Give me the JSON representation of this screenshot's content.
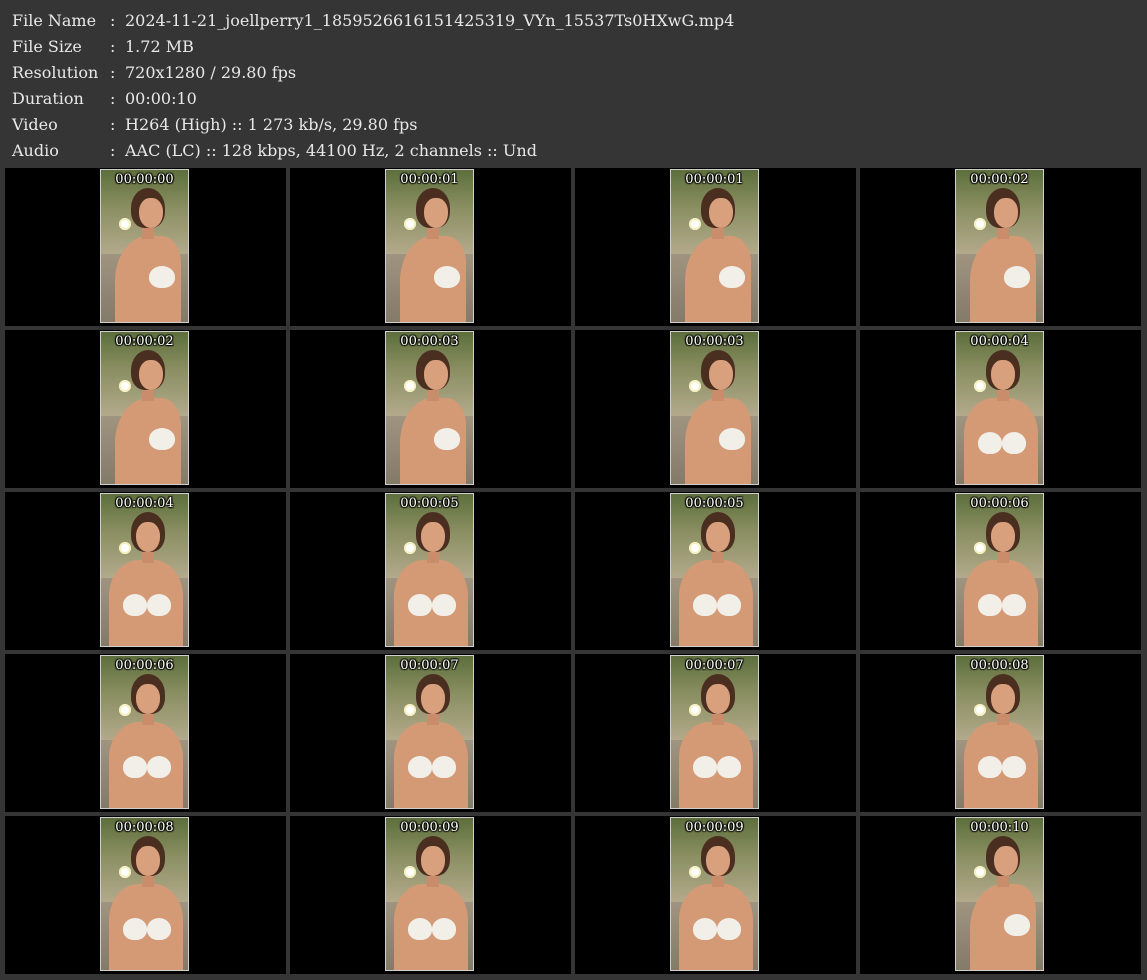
{
  "info": [
    {
      "key": "File Name",
      "sep": ":",
      "value": "2024-11-21_joellperry1_1859526616151425319_VYn_15537Ts0HXwG.mp4"
    },
    {
      "key": "File Size",
      "sep": ":",
      "value": "1.72 MB"
    },
    {
      "key": "Resolution",
      "sep": ":",
      "value": "720x1280 / 29.80 fps"
    },
    {
      "key": "Duration",
      "sep": ":",
      "value": "00:00:10"
    },
    {
      "key": "Video",
      "sep": ":",
      "value": "H264 (High) :: 1 273 kb/s, 29.80 fps"
    },
    {
      "key": "Audio",
      "sep": ":",
      "value": "AAC (LC) :: 128 kbps, 44100 Hz, 2 channels :: Und"
    }
  ],
  "thumbnails": [
    {
      "timestamp": "00:00:00",
      "pose": "side"
    },
    {
      "timestamp": "00:00:01",
      "pose": "side"
    },
    {
      "timestamp": "00:00:01",
      "pose": "side"
    },
    {
      "timestamp": "00:00:02",
      "pose": "side"
    },
    {
      "timestamp": "00:00:02",
      "pose": "side"
    },
    {
      "timestamp": "00:00:03",
      "pose": "side"
    },
    {
      "timestamp": "00:00:03",
      "pose": "side"
    },
    {
      "timestamp": "00:00:04",
      "pose": "front"
    },
    {
      "timestamp": "00:00:04",
      "pose": "front"
    },
    {
      "timestamp": "00:00:05",
      "pose": "front"
    },
    {
      "timestamp": "00:00:05",
      "pose": "front"
    },
    {
      "timestamp": "00:00:06",
      "pose": "front"
    },
    {
      "timestamp": "00:00:06",
      "pose": "front"
    },
    {
      "timestamp": "00:00:07",
      "pose": "front"
    },
    {
      "timestamp": "00:00:07",
      "pose": "front"
    },
    {
      "timestamp": "00:00:08",
      "pose": "front"
    },
    {
      "timestamp": "00:00:08",
      "pose": "front"
    },
    {
      "timestamp": "00:00:09",
      "pose": "front"
    },
    {
      "timestamp": "00:00:09",
      "pose": "front"
    },
    {
      "timestamp": "00:00:10",
      "pose": "side"
    }
  ],
  "colors": {
    "background": "#353535",
    "cell": "#000000",
    "text": "#e8e8e8"
  }
}
